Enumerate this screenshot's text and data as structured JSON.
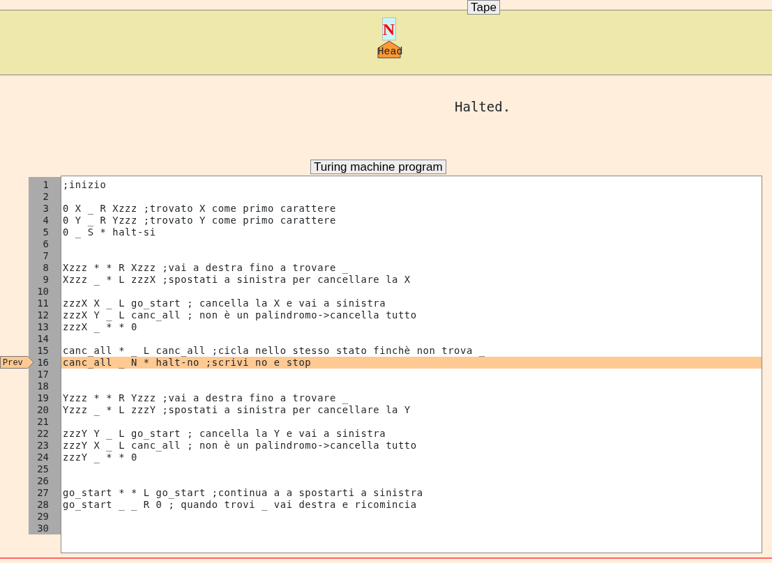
{
  "tape": {
    "legend": "Tape",
    "cells": [
      {
        "symbol": "N",
        "under_head": true
      }
    ],
    "head_label": "Head"
  },
  "status": "Halted.",
  "program": {
    "legend": "Turing machine program",
    "marker_label": "Prev",
    "lines": [
      {
        "number": "1",
        "text": ";inizio",
        "current": false
      },
      {
        "number": "2",
        "current": false
      },
      {
        "number": "3",
        "text": "0 X _ R Xzzz ;trovato X come primo carattere",
        "current": false
      },
      {
        "number": "4",
        "text": "0 Y _ R Yzzz ;trovato Y come primo carattere",
        "current": false
      },
      {
        "number": "5",
        "text": "0 _ S * halt-si",
        "current": false
      },
      {
        "number": "6",
        "current": false
      },
      {
        "number": "7",
        "current": false
      },
      {
        "number": "8",
        "text": "Xzzz * * R Xzzz ;vai a destra fino a trovare _",
        "current": false
      },
      {
        "number": "9",
        "text": "Xzzz _ * L zzzX ;spostati a sinistra per cancellare la X",
        "current": false
      },
      {
        "number": "10",
        "current": false
      },
      {
        "number": "11",
        "text": "zzzX X _ L go_start ; cancella la X e vai a sinistra",
        "current": false
      },
      {
        "number": "12",
        "text": "zzzX Y _ L canc_all ; non è un palindromo->cancella tutto",
        "current": false
      },
      {
        "number": "13",
        "text": "zzzX _ * * 0",
        "current": false
      },
      {
        "number": "14",
        "current": false
      },
      {
        "number": "15",
        "text": "canc_all * _ L canc_all ;cicla nello stesso stato finchè non trova _",
        "current": false
      },
      {
        "number": "16",
        "text": "canc_all _ N * halt-no ;scrivi no e stop",
        "current": true
      },
      {
        "number": "17",
        "current": false
      },
      {
        "number": "18",
        "current": false
      },
      {
        "number": "19",
        "text": "Yzzz * * R Yzzz ;vai a destra fino a trovare _",
        "current": false
      },
      {
        "number": "20",
        "text": "Yzzz _ * L zzzY ;spostati a sinistra per cancellare la Y",
        "current": false
      },
      {
        "number": "21",
        "current": false
      },
      {
        "number": "22",
        "text": "zzzY Y _ L go_start ; cancella la Y e vai a sinistra",
        "current": false
      },
      {
        "number": "23",
        "text": "zzzY X _ L canc_all ; non è un palindromo->cancella tutto",
        "current": false
      },
      {
        "number": "24",
        "text": "zzzY _ * * 0",
        "current": false
      },
      {
        "number": "25",
        "current": false
      },
      {
        "number": "26",
        "current": false
      },
      {
        "number": "27",
        "text": "go_start * * L go_start ;continua a a spostarti a sinistra",
        "current": false
      },
      {
        "number": "28",
        "text": "go_start _ _ R 0 ; quando trovi _ vai destra e ricomincia",
        "current": false
      },
      {
        "number": "29",
        "current": false
      },
      {
        "number": "30",
        "current": false
      }
    ]
  }
}
